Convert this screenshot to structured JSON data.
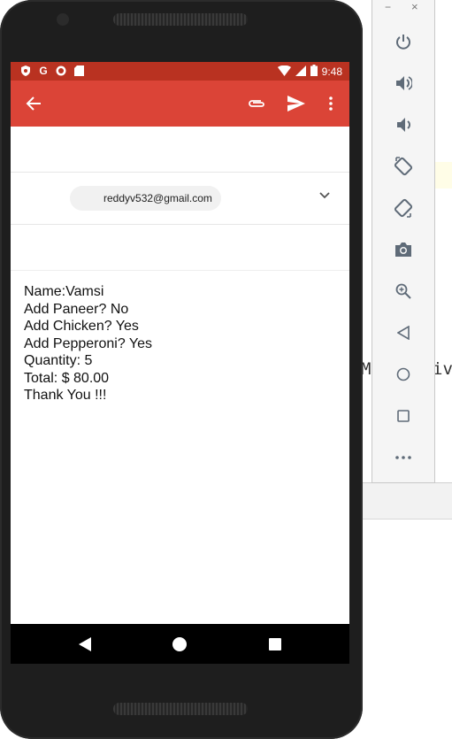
{
  "status_bar": {
    "time": "9:48"
  },
  "compose": {
    "to_chip": "reddyv532@gmail.com"
  },
  "message_lines": [
    "Name:Vamsi",
    "Add Paneer? No",
    "Add Chicken? Yes",
    "Add Pepperoni? Yes",
    "Quantity: 5",
    "Total: $ 80.00",
    "Thank You !!!"
  ],
  "emulator_panel": {
    "minimize": "−",
    "close": "×"
  },
  "background_code": {
    "left": "M",
    "right": "iv"
  },
  "colors": {
    "status_bar": "#b93221",
    "toolbar": "#db4437",
    "chip": "#f1f1f1"
  },
  "icons": [
    "back-arrow-icon",
    "attach-icon",
    "send-icon",
    "more-vert-icon",
    "chevron-down-icon",
    "power-icon",
    "volume-up-icon",
    "volume-down-icon",
    "rotate-left-icon",
    "rotate-right-icon",
    "camera-icon",
    "zoom-icon",
    "back-triangle-icon",
    "home-circle-icon",
    "overview-square-icon",
    "more-horiz-icon"
  ]
}
